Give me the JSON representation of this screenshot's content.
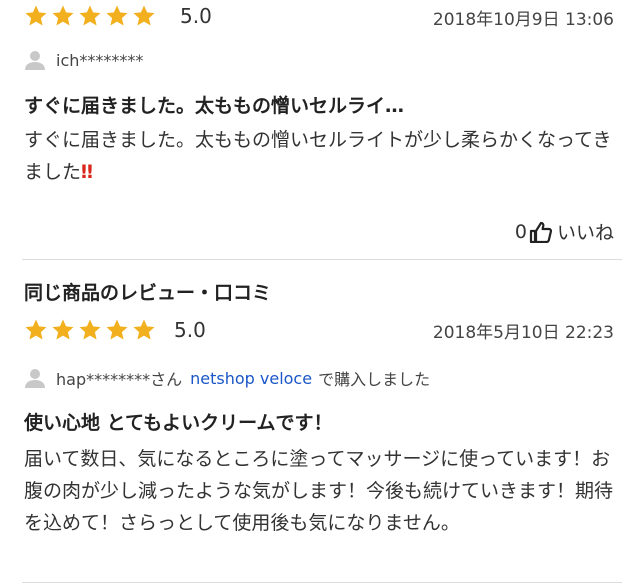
{
  "review1": {
    "rating_value": 5,
    "rating_text": "5.0",
    "date": "2018年10月9日 13:06",
    "username": "ich********",
    "title": "すぐに届きました。太ももの憎いセルライ…",
    "body_text": "すぐに届きました。太ももの憎いセルライトが少し柔らかくなってきました",
    "body_emoji": "‼",
    "like_count": "0",
    "like_label": "いいね"
  },
  "section": {
    "heading": "同じ商品のレビュー・口コミ"
  },
  "review2": {
    "rating_value": 5,
    "rating_text": "5.0",
    "date": "2018年5月10日 22:23",
    "username": "hap********さん",
    "shop": "netshop veloce",
    "purchase_suffix": "で購入しました",
    "title": "使い心地 とてもよいクリームです！",
    "body": "届いて数日、気になるところに塗ってマッサージに使っています！お腹の肉が少し減ったような気がします！今後も続けていきます！期待を込めて！さらっとして使用後も気になりません。"
  },
  "colors": {
    "star": "#f2b01e",
    "link": "#1a56c8",
    "divider": "#dcdcdc",
    "emoji": "#d9261c"
  },
  "icons": [
    "star-icon",
    "user-avatar-icon",
    "thumbs-up-icon"
  ]
}
